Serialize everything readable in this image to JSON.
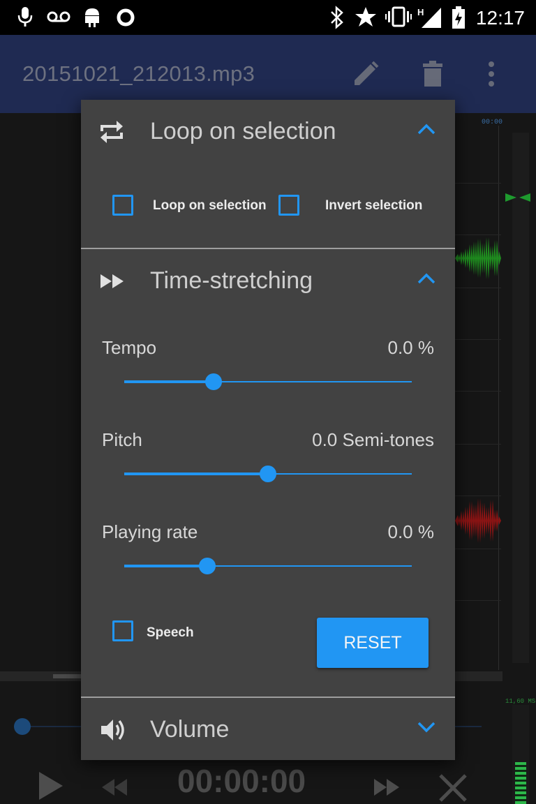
{
  "status_bar": {
    "time": "12:17",
    "icons": [
      "mic-icon",
      "voicemail-icon",
      "android-icon",
      "circle-o-icon",
      "bluetooth-icon",
      "star-icon",
      "vibrate-icon",
      "signal-h-icon",
      "battery-icon"
    ]
  },
  "app_bar": {
    "title": "20151021_212013.mp3",
    "actions": [
      "edit-icon",
      "delete-icon",
      "more-vert-icon"
    ]
  },
  "background": {
    "time_marker": "00:00",
    "meter_label": "11,60 MS",
    "timecode": "00:00:00"
  },
  "dialog": {
    "loop_section": {
      "title": "Loop on selection",
      "loop_checkbox": {
        "label": "Loop on selection",
        "checked": false
      },
      "invert_checkbox": {
        "label": "Invert selection",
        "checked": false
      }
    },
    "stretch_section": {
      "title": "Time-stretching",
      "tempo": {
        "label": "Tempo",
        "value_text": "0.0 %",
        "position": 0.31
      },
      "pitch": {
        "label": "Pitch",
        "value_text": "0.0 Semi-tones",
        "position": 0.5
      },
      "rate": {
        "label": "Playing rate",
        "value_text": "0.0 %",
        "position": 0.29
      },
      "speech_checkbox": {
        "label": "Speech",
        "checked": false
      },
      "reset_label": "RESET"
    },
    "volume_section": {
      "title": "Volume"
    }
  },
  "colors": {
    "accent": "#2196f3",
    "dialog_bg": "#424242",
    "app_bar": "#1f2a52"
  }
}
